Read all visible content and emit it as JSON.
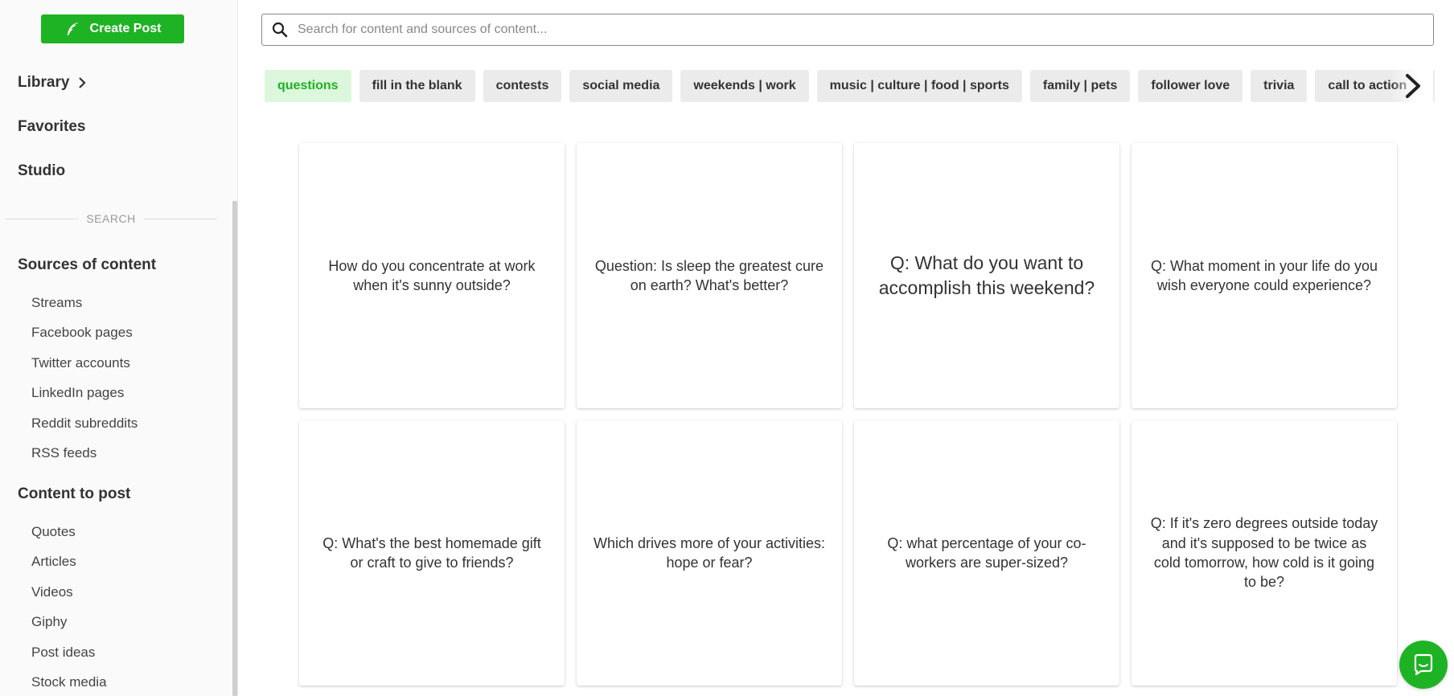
{
  "sidebar": {
    "create_post_label": "Create Post",
    "library_label": "Library",
    "favorites_label": "Favorites",
    "studio_label": "Studio",
    "search_divider_label": "SEARCH",
    "sources_title": "Sources of content",
    "sources_items": [
      "Streams",
      "Facebook pages",
      "Twitter accounts",
      "LinkedIn pages",
      "Reddit subreddits",
      "RSS feeds"
    ],
    "content_title": "Content to post",
    "content_items": [
      "Quotes",
      "Articles",
      "Videos",
      "Giphy",
      "Post ideas",
      "Stock media"
    ]
  },
  "search": {
    "placeholder": "Search for content and sources of content..."
  },
  "chips": [
    "questions",
    "fill in the blank",
    "contests",
    "social media",
    "weekends | work",
    "music | culture | food | sports",
    "family | pets",
    "follower love",
    "trivia",
    "call to action"
  ],
  "active_chip": "questions",
  "cards": [
    "How do you concentrate at work when it's sunny outside?",
    "Question: Is sleep the greatest cure on earth? What's better?",
    "Q: What do you want to accomplish this weekend?",
    "Q: What moment in your life do you wish everyone could experience?",
    "Q: What's the best homemade gift or craft to give to friends?",
    "Which drives more of your activities: hope or fear?",
    "Q: what percentage of your co-workers are super-sized?",
    "Q: If it's zero degrees outside today and it's supposed to be twice as cold tomorrow, how cold is it going to be?"
  ],
  "colors": {
    "brand_green": "#1eb324",
    "active_chip_bg": "#dcf7dc",
    "chip_bg": "#ebebeb"
  },
  "icons": {
    "create_post": "feather-icon",
    "library_chevron": "chevron-right-icon",
    "search": "search-icon",
    "chips_next": "chevron-right-icon",
    "chat": "chat-bubble-icon"
  }
}
